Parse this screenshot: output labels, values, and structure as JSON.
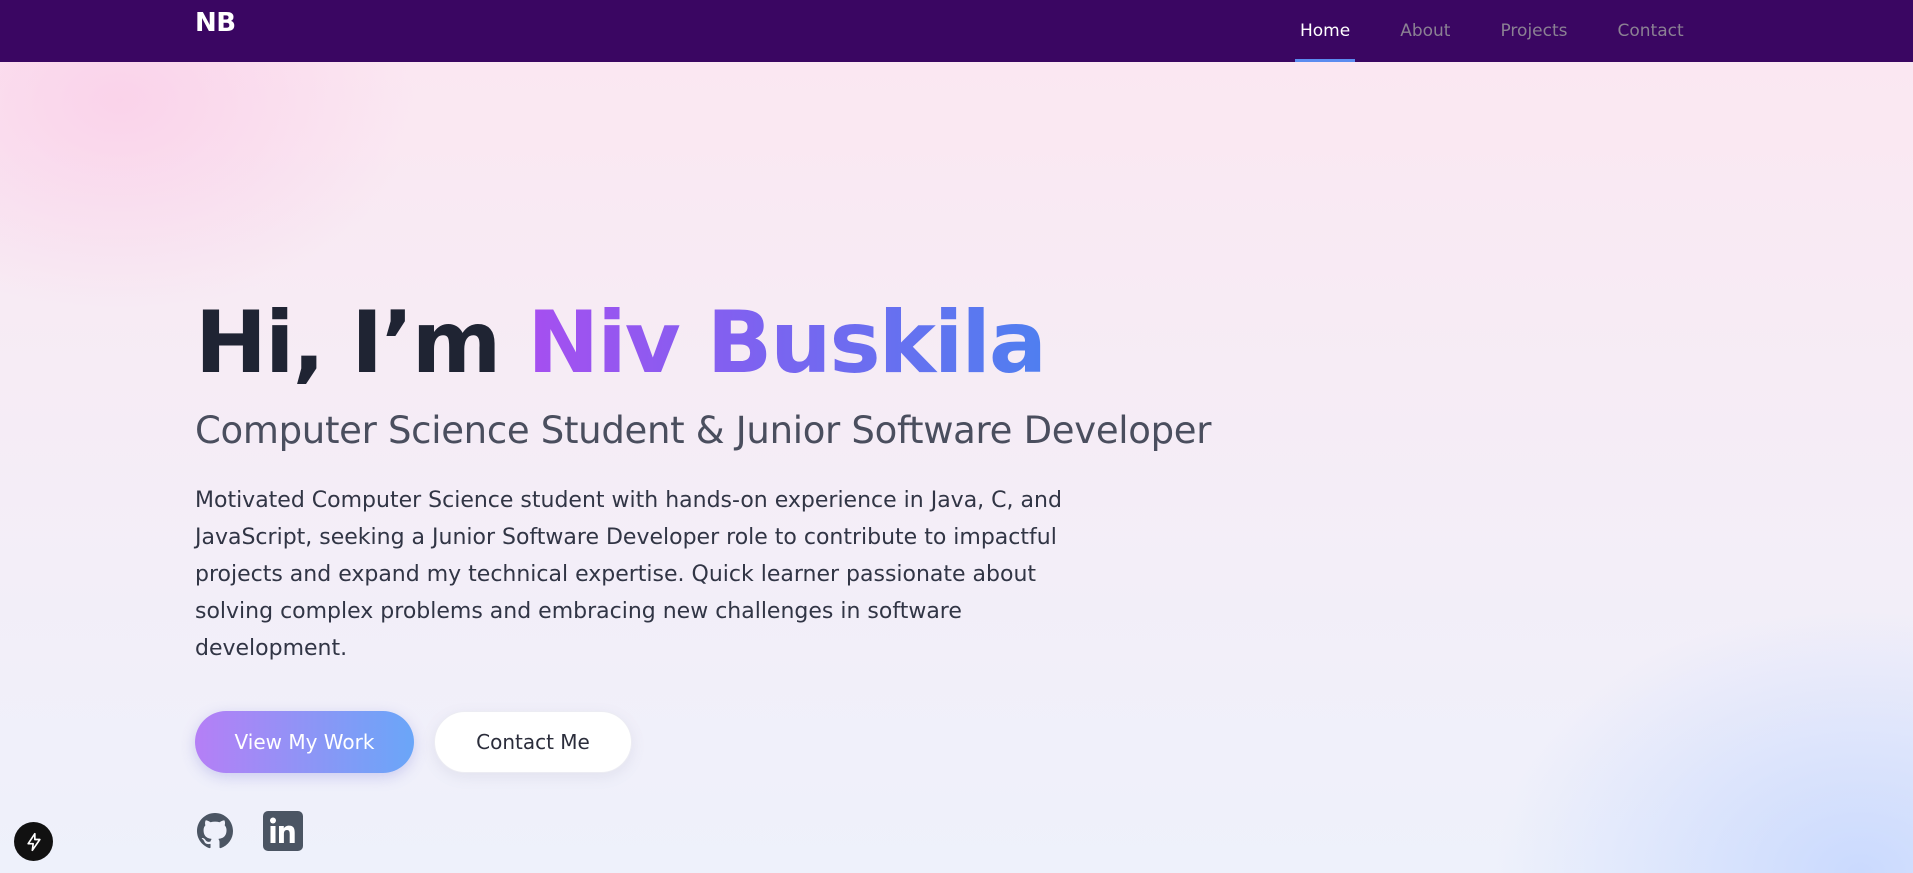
{
  "nav": {
    "logo": "NB",
    "links": [
      {
        "label": "Home",
        "active": true
      },
      {
        "label": "About",
        "active": false
      },
      {
        "label": "Projects",
        "active": false
      },
      {
        "label": "Contact",
        "active": false
      }
    ]
  },
  "hero": {
    "greeting": "Hi, I’m",
    "name": "Niv Buskila",
    "subtitle": "Computer Science Student & Junior Software Developer",
    "description": "Motivated Computer Science student with hands-on experience in Java, C, and JavaScript, seeking a Junior Software Developer role to contribute to impactful projects and expand my technical expertise. Quick learner passionate about solving complex problems and embracing new challenges in software development.",
    "primary_button": "View My Work",
    "secondary_button": "Contact Me",
    "socials": [
      {
        "icon": "github-icon"
      },
      {
        "icon": "linkedin-icon"
      }
    ]
  },
  "floating_badge": {
    "icon": "lightning-bolt-icon"
  },
  "colors": {
    "nav_background": "#3a0662",
    "nav_active_underline": "#5b8cf0",
    "name_gradient_start": "#a64ff0",
    "name_gradient_end": "#4f7ff0",
    "title_text": "#1f2433",
    "primary_button_start": "#b57ff6",
    "primary_button_end": "#6aa6f8"
  }
}
